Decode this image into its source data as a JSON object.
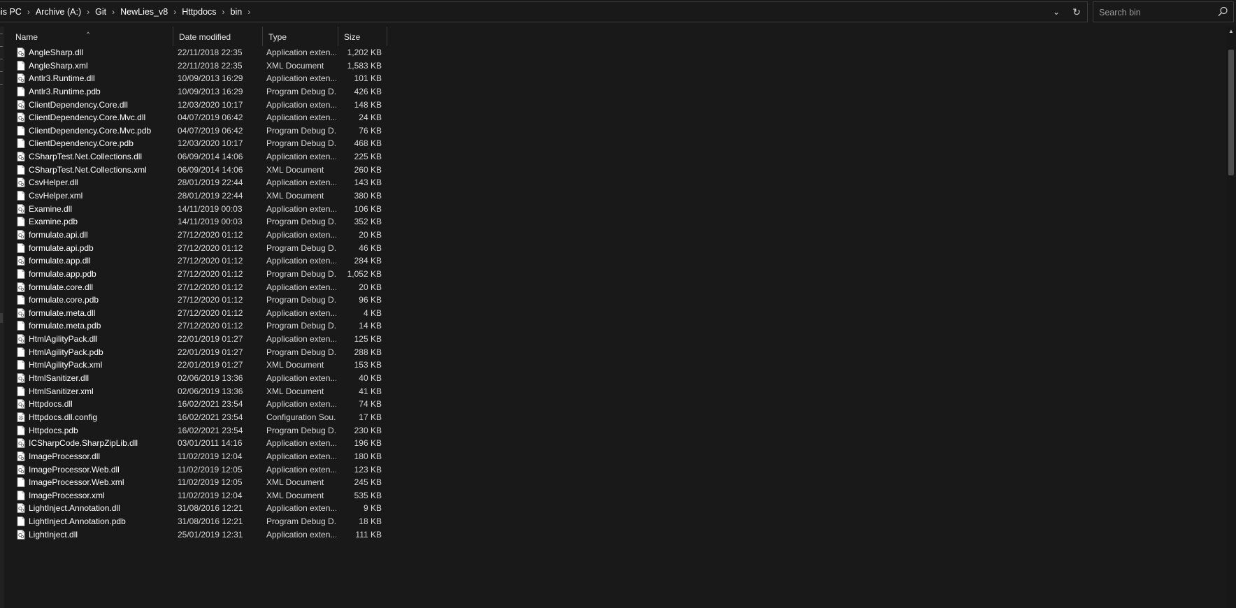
{
  "breadcrumb": [
    "his PC",
    "Archive (A:)",
    "Git",
    "NewLies_v8",
    "Httpdocs",
    "bin"
  ],
  "search": {
    "placeholder": "Search bin"
  },
  "columns": {
    "name": "Name",
    "date": "Date modified",
    "type": "Type",
    "size": "Size"
  },
  "files": [
    {
      "name": "AngleSharp.dll",
      "date": "22/11/2018 22:35",
      "type": "Application exten...",
      "size": "1,202 KB",
      "icon": "dll-file-icon"
    },
    {
      "name": "AngleSharp.xml",
      "date": "22/11/2018 22:35",
      "type": "XML Document",
      "size": "1,583 KB",
      "icon": "document-file-icon"
    },
    {
      "name": "Antlr3.Runtime.dll",
      "date": "10/09/2013 16:29",
      "type": "Application exten...",
      "size": "101 KB",
      "icon": "dll-file-icon"
    },
    {
      "name": "Antlr3.Runtime.pdb",
      "date": "10/09/2013 16:29",
      "type": "Program Debug D...",
      "size": "426 KB",
      "icon": "document-file-icon"
    },
    {
      "name": "ClientDependency.Core.dll",
      "date": "12/03/2020 10:17",
      "type": "Application exten...",
      "size": "148 KB",
      "icon": "dll-file-icon"
    },
    {
      "name": "ClientDependency.Core.Mvc.dll",
      "date": "04/07/2019 06:42",
      "type": "Application exten...",
      "size": "24 KB",
      "icon": "dll-file-icon"
    },
    {
      "name": "ClientDependency.Core.Mvc.pdb",
      "date": "04/07/2019 06:42",
      "type": "Program Debug D...",
      "size": "76 KB",
      "icon": "document-file-icon"
    },
    {
      "name": "ClientDependency.Core.pdb",
      "date": "12/03/2020 10:17",
      "type": "Program Debug D...",
      "size": "468 KB",
      "icon": "document-file-icon"
    },
    {
      "name": "CSharpTest.Net.Collections.dll",
      "date": "06/09/2014 14:06",
      "type": "Application exten...",
      "size": "225 KB",
      "icon": "dll-file-icon"
    },
    {
      "name": "CSharpTest.Net.Collections.xml",
      "date": "06/09/2014 14:06",
      "type": "XML Document",
      "size": "260 KB",
      "icon": "document-file-icon"
    },
    {
      "name": "CsvHelper.dll",
      "date": "28/01/2019 22:44",
      "type": "Application exten...",
      "size": "143 KB",
      "icon": "dll-file-icon"
    },
    {
      "name": "CsvHelper.xml",
      "date": "28/01/2019 22:44",
      "type": "XML Document",
      "size": "380 KB",
      "icon": "document-file-icon"
    },
    {
      "name": "Examine.dll",
      "date": "14/11/2019 00:03",
      "type": "Application exten...",
      "size": "106 KB",
      "icon": "dll-file-icon"
    },
    {
      "name": "Examine.pdb",
      "date": "14/11/2019 00:03",
      "type": "Program Debug D...",
      "size": "352 KB",
      "icon": "document-file-icon"
    },
    {
      "name": "formulate.api.dll",
      "date": "27/12/2020 01:12",
      "type": "Application exten...",
      "size": "20 KB",
      "icon": "dll-file-icon"
    },
    {
      "name": "formulate.api.pdb",
      "date": "27/12/2020 01:12",
      "type": "Program Debug D...",
      "size": "46 KB",
      "icon": "document-file-icon"
    },
    {
      "name": "formulate.app.dll",
      "date": "27/12/2020 01:12",
      "type": "Application exten...",
      "size": "284 KB",
      "icon": "dll-file-icon"
    },
    {
      "name": "formulate.app.pdb",
      "date": "27/12/2020 01:12",
      "type": "Program Debug D...",
      "size": "1,052 KB",
      "icon": "document-file-icon"
    },
    {
      "name": "formulate.core.dll",
      "date": "27/12/2020 01:12",
      "type": "Application exten...",
      "size": "20 KB",
      "icon": "dll-file-icon"
    },
    {
      "name": "formulate.core.pdb",
      "date": "27/12/2020 01:12",
      "type": "Program Debug D...",
      "size": "96 KB",
      "icon": "document-file-icon"
    },
    {
      "name": "formulate.meta.dll",
      "date": "27/12/2020 01:12",
      "type": "Application exten...",
      "size": "4 KB",
      "icon": "dll-file-icon"
    },
    {
      "name": "formulate.meta.pdb",
      "date": "27/12/2020 01:12",
      "type": "Program Debug D...",
      "size": "14 KB",
      "icon": "document-file-icon"
    },
    {
      "name": "HtmlAgilityPack.dll",
      "date": "22/01/2019 01:27",
      "type": "Application exten...",
      "size": "125 KB",
      "icon": "dll-file-icon"
    },
    {
      "name": "HtmlAgilityPack.pdb",
      "date": "22/01/2019 01:27",
      "type": "Program Debug D...",
      "size": "288 KB",
      "icon": "document-file-icon"
    },
    {
      "name": "HtmlAgilityPack.xml",
      "date": "22/01/2019 01:27",
      "type": "XML Document",
      "size": "153 KB",
      "icon": "document-file-icon"
    },
    {
      "name": "HtmlSanitizer.dll",
      "date": "02/06/2019 13:36",
      "type": "Application exten...",
      "size": "40 KB",
      "icon": "dll-file-icon"
    },
    {
      "name": "HtmlSanitizer.xml",
      "date": "02/06/2019 13:36",
      "type": "XML Document",
      "size": "41 KB",
      "icon": "document-file-icon"
    },
    {
      "name": "Httpdocs.dll",
      "date": "16/02/2021 23:54",
      "type": "Application exten...",
      "size": "74 KB",
      "icon": "dll-file-icon"
    },
    {
      "name": "Httpdocs.dll.config",
      "date": "16/02/2021 23:54",
      "type": "Configuration Sou...",
      "size": "17 KB",
      "icon": "config-file-icon"
    },
    {
      "name": "Httpdocs.pdb",
      "date": "16/02/2021 23:54",
      "type": "Program Debug D...",
      "size": "230 KB",
      "icon": "document-file-icon"
    },
    {
      "name": "ICSharpCode.SharpZipLib.dll",
      "date": "03/01/2011 14:16",
      "type": "Application exten...",
      "size": "196 KB",
      "icon": "dll-file-icon"
    },
    {
      "name": "ImageProcessor.dll",
      "date": "11/02/2019 12:04",
      "type": "Application exten...",
      "size": "180 KB",
      "icon": "dll-file-icon"
    },
    {
      "name": "ImageProcessor.Web.dll",
      "date": "11/02/2019 12:05",
      "type": "Application exten...",
      "size": "123 KB",
      "icon": "dll-file-icon"
    },
    {
      "name": "ImageProcessor.Web.xml",
      "date": "11/02/2019 12:05",
      "type": "XML Document",
      "size": "245 KB",
      "icon": "document-file-icon"
    },
    {
      "name": "ImageProcessor.xml",
      "date": "11/02/2019 12:04",
      "type": "XML Document",
      "size": "535 KB",
      "icon": "document-file-icon"
    },
    {
      "name": "LightInject.Annotation.dll",
      "date": "31/08/2016 12:21",
      "type": "Application exten...",
      "size": "9 KB",
      "icon": "dll-file-icon"
    },
    {
      "name": "LightInject.Annotation.pdb",
      "date": "31/08/2016 12:21",
      "type": "Program Debug D...",
      "size": "18 KB",
      "icon": "document-file-icon"
    },
    {
      "name": "LightInject.dll",
      "date": "25/01/2019 12:31",
      "type": "Application exten...",
      "size": "111 KB",
      "icon": "dll-file-icon"
    }
  ]
}
